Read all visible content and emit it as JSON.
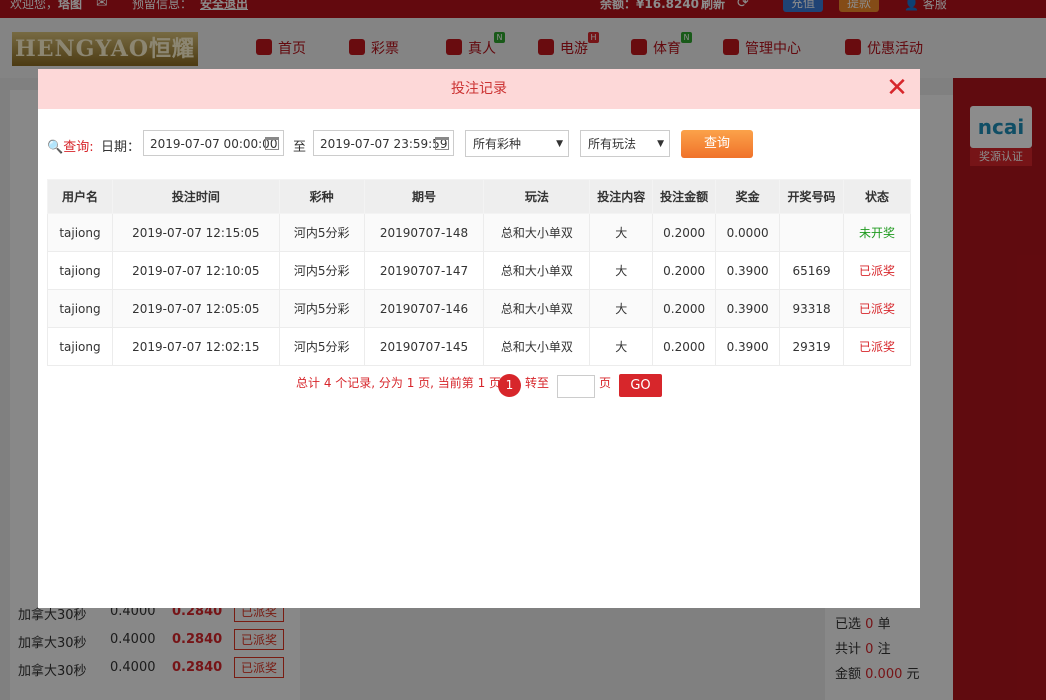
{
  "topbar": {
    "welcome": "欢迎您，",
    "username": "塔图",
    "reserved_info": "预留信息：",
    "logout": "安全退出",
    "balance_label": "余额：",
    "balance_value": "¥16.8240",
    "refresh": "刷新",
    "recharge": "充值",
    "withdraw": "提款",
    "service": "客服"
  },
  "header": {
    "logo_text": "HENGYAO恒耀",
    "nav": [
      {
        "label": "首页"
      },
      {
        "label": "彩票"
      },
      {
        "label": "真人",
        "badge": "N"
      },
      {
        "label": "电游",
        "badge": "H"
      },
      {
        "label": "体育",
        "badge": "N"
      },
      {
        "label": "管理中心"
      },
      {
        "label": "优惠活动"
      }
    ]
  },
  "background": {
    "left_rows": [
      {
        "name": "加拿大30秒",
        "amount": "0.4000",
        "win": "0.2840",
        "status": "已派奖"
      },
      {
        "name": "加拿大30秒",
        "amount": "0.4000",
        "win": "0.2840",
        "status": "已派奖"
      },
      {
        "name": "加拿大30秒",
        "amount": "0.4000",
        "win": "0.2840",
        "status": "已派奖"
      }
    ],
    "right": {
      "badge_brand": "ncai",
      "badge_text": "奖源认证",
      "selected_label": "已选",
      "selected_count": "0",
      "selected_unit": "单",
      "total_label": "共计",
      "total_count": "0",
      "total_unit": "注",
      "amount_label": "金额",
      "amount_value": "0.000",
      "amount_unit": "元"
    }
  },
  "modal": {
    "title": "投注记录",
    "query_label": "查询:",
    "date_label": "日期：",
    "date_from": "2019-07-07 00:00:00",
    "to_label": "至",
    "date_to": "2019-07-07 23:59:59",
    "lottery_select": "所有彩种",
    "play_select": "所有玩法",
    "query_button": "查询",
    "columns": [
      "用户名",
      "投注时间",
      "彩种",
      "期号",
      "玩法",
      "投注内容",
      "投注金额",
      "奖金",
      "开奖号码",
      "状态"
    ],
    "rows": [
      {
        "user": "tajiong",
        "time": "2019-07-07 12:15:05",
        "lottery": "河内5分彩",
        "issue": "20190707-148",
        "play": "总和大小单双",
        "content": "大",
        "amount": "0.2000",
        "prize": "0.0000",
        "number": "",
        "status": "未开奖",
        "status_type": "pending"
      },
      {
        "user": "tajiong",
        "time": "2019-07-07 12:10:05",
        "lottery": "河内5分彩",
        "issue": "20190707-147",
        "play": "总和大小单双",
        "content": "大",
        "amount": "0.2000",
        "prize": "0.3900",
        "number": "65169",
        "status": "已派奖",
        "status_type": "paid"
      },
      {
        "user": "tajiong",
        "time": "2019-07-07 12:05:05",
        "lottery": "河内5分彩",
        "issue": "20190707-146",
        "play": "总和大小单双",
        "content": "大",
        "amount": "0.2000",
        "prize": "0.3900",
        "number": "93318",
        "status": "已派奖",
        "status_type": "paid"
      },
      {
        "user": "tajiong",
        "time": "2019-07-07 12:02:15",
        "lottery": "河内5分彩",
        "issue": "20190707-145",
        "play": "总和大小单双",
        "content": "大",
        "amount": "0.2000",
        "prize": "0.3900",
        "number": "29319",
        "status": "已派奖",
        "status_type": "paid"
      }
    ],
    "pager": {
      "summary": "总计 4 个记录, 分为 1 页, 当前第 1 页",
      "current": "1",
      "goto_label": "转至",
      "page_label": "页",
      "go": "GO"
    }
  },
  "colors": {
    "brand_red": "#d7262b",
    "paid": "#d7262b",
    "pending": "#1f9a1f"
  }
}
